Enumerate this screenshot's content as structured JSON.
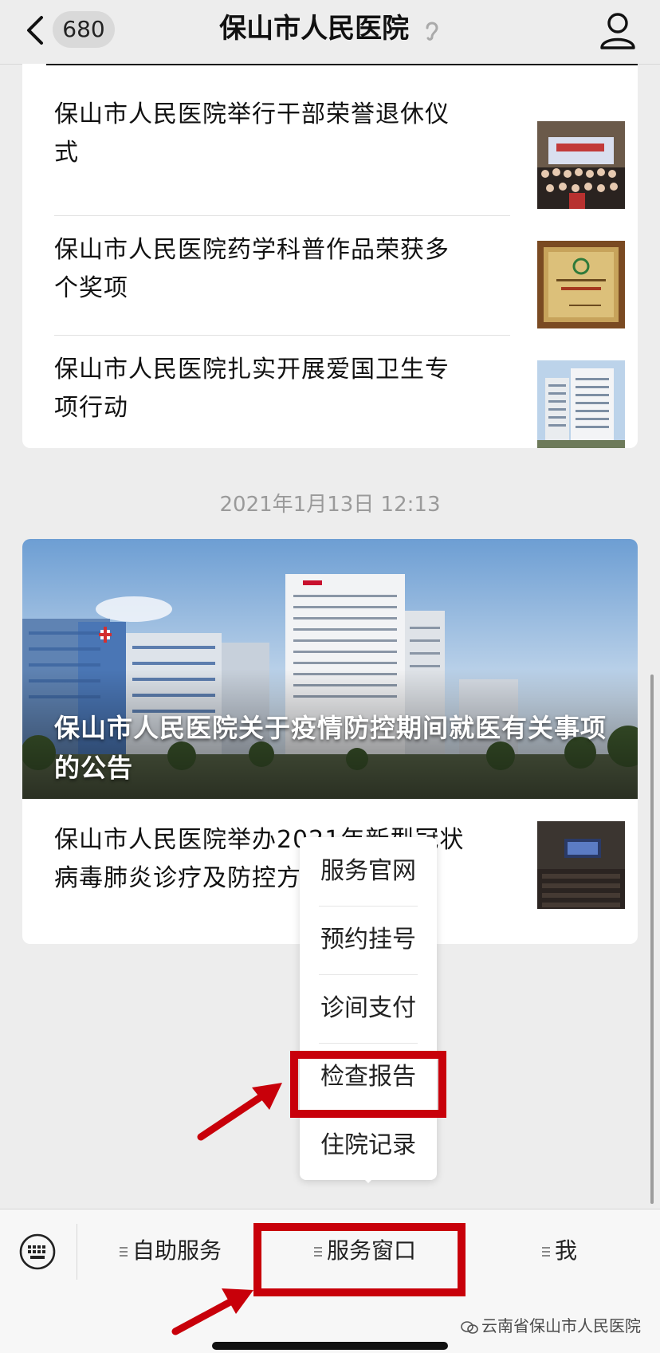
{
  "nav": {
    "back_count": "680",
    "title": "保山市人民医院"
  },
  "articles": [
    {
      "title": "保山市人民医院举行干部荣誉退休仪式"
    },
    {
      "title": "保山市人民医院药学科普作品荣获多个奖项"
    },
    {
      "title": "保山市人民医院扎实开展爱国卫生专项行动"
    }
  ],
  "timestamp": "2021年1月13日 12:13",
  "feature": {
    "hero_title": "保山市人民医院关于疫情防控期间就医有关事项的公告",
    "sub_article_title": "保山市人民医院举办2021年新型冠状病毒肺炎诊疗及防控方案培训"
  },
  "popup_menu": {
    "items": [
      "服务官网",
      "预约挂号",
      "诊间支付",
      "检查报告",
      "住院记录"
    ],
    "highlighted_index": 3
  },
  "bottom_bar": {
    "tabs": [
      "自助服务",
      "服务窗口",
      "我"
    ],
    "highlighted_tab": "服务窗口"
  },
  "watermark": "云南省保山市人民医院",
  "colors": {
    "highlight": "#c8000a",
    "background": "#ededed",
    "card": "#ffffff"
  }
}
